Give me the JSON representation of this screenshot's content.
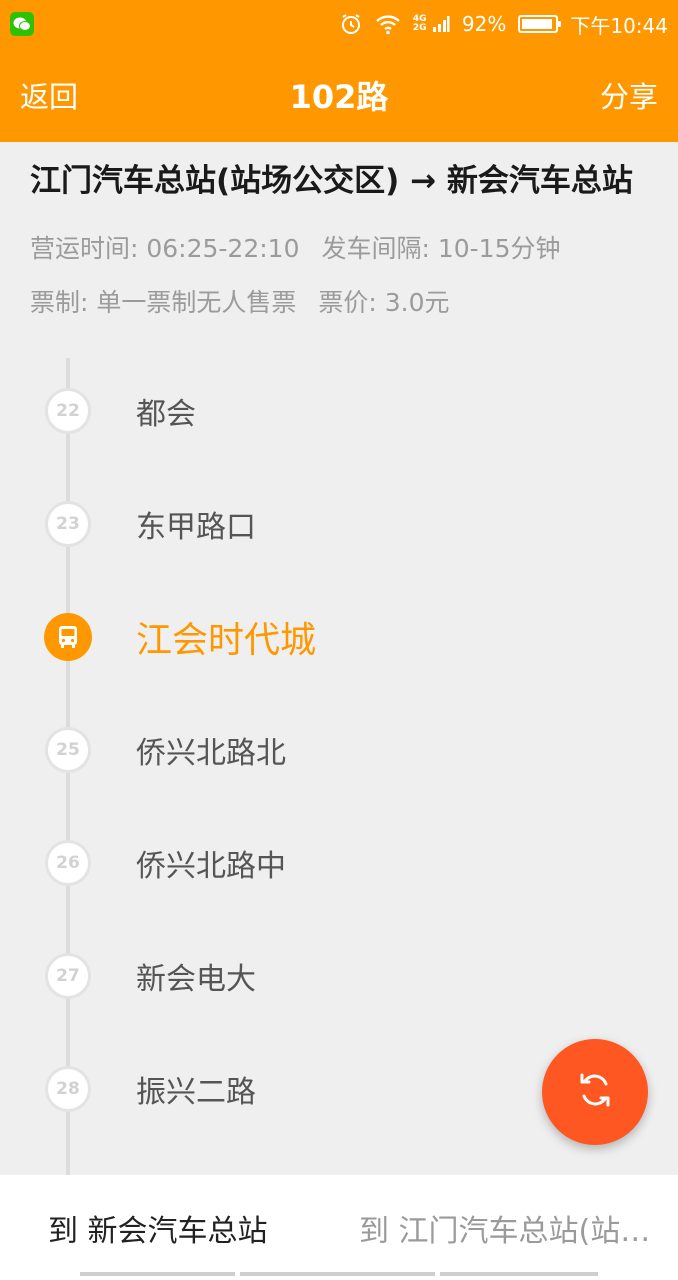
{
  "status_bar": {
    "app_icon": "wechat-icon",
    "network": "4G 2G",
    "battery": "92%",
    "battery_level": 0.92,
    "time": "下午10:44"
  },
  "app_bar": {
    "back_label": "返回",
    "title": "102路",
    "share_label": "分享"
  },
  "route": {
    "name": "江门汽车总站(站场公交区) → 新会汽车总站",
    "operating_time": "营运时间: 06:25-22:10",
    "interval": "发车间隔: 10-15分钟",
    "ticket_type": "票制: 单一票制无人售票",
    "fare": "票价: 3.0元"
  },
  "stops": [
    {
      "number": "22",
      "name": "都会"
    },
    {
      "number": "23",
      "name": "东甲路口"
    },
    {
      "number": "",
      "name": "江会时代城",
      "current": true
    },
    {
      "number": "25",
      "name": "侨兴北路北"
    },
    {
      "number": "26",
      "name": "侨兴北路中"
    },
    {
      "number": "27",
      "name": "新会电大"
    },
    {
      "number": "28",
      "name": "振兴二路"
    }
  ],
  "fab": {
    "icon": "refresh-icon"
  },
  "tabs": [
    {
      "label": "到 新会汽车总站",
      "active": true
    },
    {
      "label": "到 江门汽车总站(站场...",
      "active": false
    }
  ],
  "colors": {
    "accent": "#ff9800",
    "fab": "#ff5722"
  }
}
